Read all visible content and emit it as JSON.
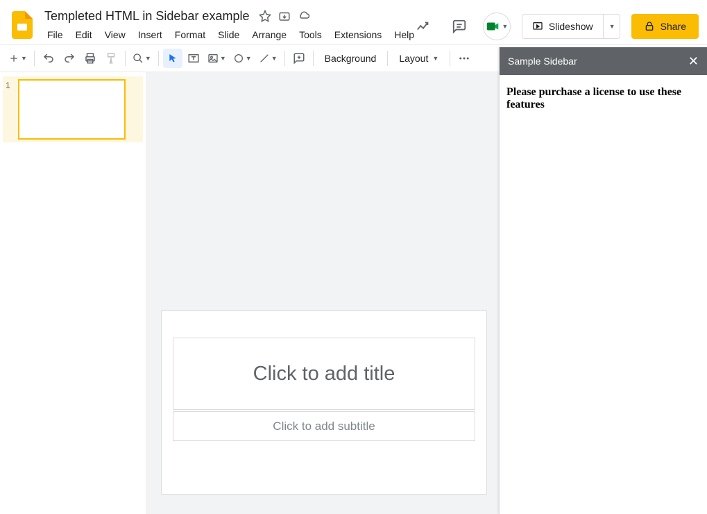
{
  "doc": {
    "title": "Templeted HTML in Sidebar example"
  },
  "menu": {
    "file": "File",
    "edit": "Edit",
    "view": "View",
    "insert": "Insert",
    "format": "Format",
    "slide": "Slide",
    "arrange": "Arrange",
    "tools": "Tools",
    "extensions": "Extensions",
    "help": "Help"
  },
  "header_actions": {
    "slideshow": "Slideshow",
    "share": "Share"
  },
  "toolbar": {
    "background": "Background",
    "layout": "Layout"
  },
  "thumbnails": {
    "slide1_number": "1"
  },
  "slide": {
    "title_placeholder": "Click to add title",
    "subtitle_placeholder": "Click to add subtitle"
  },
  "sidebar": {
    "title": "Sample Sidebar",
    "message": "Please purchase a license to use these features"
  }
}
